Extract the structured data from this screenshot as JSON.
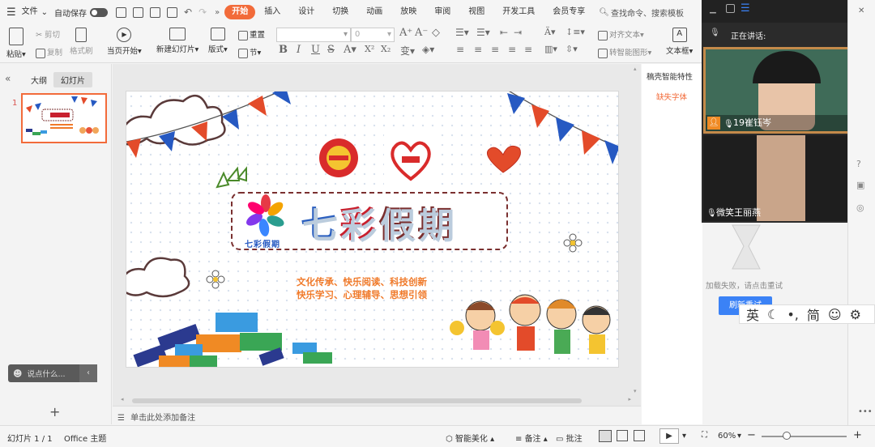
{
  "menu": {
    "file": "文件",
    "autosave": "自动保存"
  },
  "tabs": [
    "开始",
    "插入",
    "设计",
    "切换",
    "动画",
    "放映",
    "审阅",
    "视图",
    "开发工具",
    "会员专享"
  ],
  "search_placeholder": "查找命令、搜索模板",
  "ribbon": {
    "paste": "粘贴",
    "cut": "剪切",
    "copy": "复制",
    "format_painter": "格式刷",
    "play_current": "当页开始",
    "new_slide": "新建幻灯片",
    "layout": "版式",
    "reset": "重置",
    "section": "节",
    "font_size": "0",
    "align_text": "对齐文本",
    "smart_graphic": "转智能图形",
    "text_box": "文本框"
  },
  "left_panel": {
    "tab_outline": "大纲",
    "tab_slides": "幻灯片",
    "slide_number": "1",
    "chat_placeholder": "说点什么..."
  },
  "slide": {
    "title": "七彩假期",
    "logo_text": "七彩假期",
    "line1": "文化传承、快乐阅读、科技创新",
    "line2": "快乐学习、心理辅导、思想引领"
  },
  "notes_placeholder": "单击此处添加备注",
  "right_panel": {
    "smart_features": "稿壳智能特性",
    "missing_fonts": "缺失字体",
    "load_failed": "加载失败，请点击重试",
    "refresh": "刷新重试"
  },
  "video": {
    "speaking_label": "正在讲话:",
    "user1": "19崔钰岑",
    "user2": "微笑王丽燕"
  },
  "ime": {
    "lang": "英",
    "simplified": "简"
  },
  "status": {
    "slide_count": "幻灯片 1 / 1",
    "theme": "Office 主题",
    "smart_beautify": "智能美化",
    "notes": "备注",
    "comments": "批注",
    "zoom": "60%"
  },
  "colors": {
    "accent": "#f26b3a",
    "title_blue": "#2b5fbf",
    "title_red": "#c8202e",
    "subtitle": "#f07a2a"
  }
}
